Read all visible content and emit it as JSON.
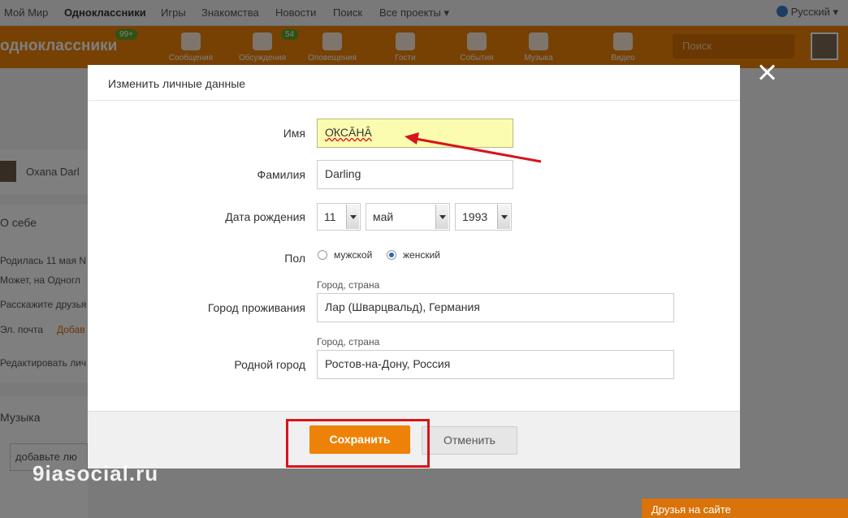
{
  "topbar": {
    "links": [
      "Мой Мир",
      "Одноклассники",
      "Игры",
      "Знакомства",
      "Новости",
      "Поиск",
      "Все проекты ▾"
    ],
    "language": "Русский ▾"
  },
  "header": {
    "brand": "одноклассники",
    "brand_badge": "99+",
    "nav": [
      "Сообщения",
      "Обсуждения",
      "Оповещения",
      "Гости",
      "События",
      "Музыка",
      "Видео"
    ],
    "discussions_badge": "54",
    "search_placeholder": "Поиск"
  },
  "background": {
    "user_name": "Oxana Darl",
    "about_title": "О себе",
    "lines": [
      "Родилась 11 мая  N",
      "Может, на Одногл",
      "Расскажите друзья",
      "Эл. почта",
      "Редактировать лич"
    ],
    "email_add": "Добав",
    "music_title": "Музыка",
    "music_input": "добавьте лю",
    "bottom_strip": "Друзья на сайте"
  },
  "dialog": {
    "title": "Изменить личные данные",
    "fields": {
      "first_name_label": "Имя",
      "first_name_value": "О҆КСӐНȂ",
      "last_name_label": "Фамилия",
      "last_name_value": "Darling",
      "birthdate_label": "Дата рождения",
      "birth_day": "11",
      "birth_month": "май",
      "birth_year": "1993",
      "gender_label": "Пол",
      "gender_male": "мужской",
      "gender_female": "женский",
      "gender_selected": "женский",
      "city_hint": "Город, страна",
      "city_label": "Город проживания",
      "city_value": "Лар (Шварцвальд), Германия",
      "hometown_hint": "Город, страна",
      "hometown_label": "Родной город",
      "hometown_value": "Ростов-на-Дону, Россия"
    },
    "save_label": "Сохранить",
    "cancel_label": "Отменить"
  },
  "watermark": "9iasocial.ru",
  "colors": {
    "brand_orange": "#ee8208",
    "highlight_field": "#fbfcb0",
    "annotation_red": "#d7141c"
  }
}
